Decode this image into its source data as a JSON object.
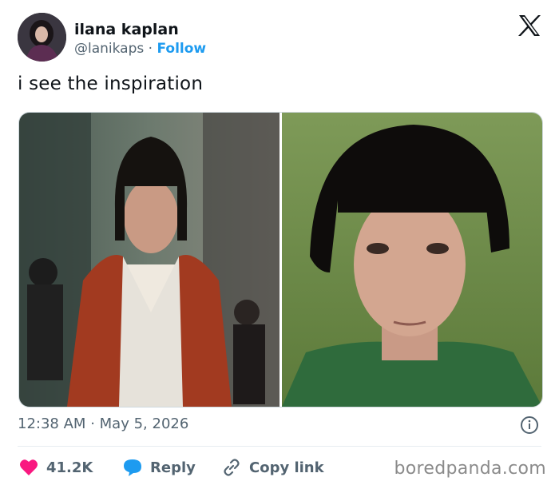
{
  "author": {
    "name": "ilana kaplan",
    "handle": "@lanikaps",
    "separator": "·",
    "follow_label": "Follow"
  },
  "tweet": {
    "text": "i see the inspiration",
    "time": "12:38 AM",
    "separator": "·",
    "date": "May 5, 2026"
  },
  "actions": {
    "likes": "41.2K",
    "reply_label": "Reply",
    "copy_label": "Copy link"
  },
  "watermark": "boredpanda.com",
  "colors": {
    "accent": "#1d9bf0",
    "like": "#f91880",
    "text": "#0f1419",
    "muted": "#536471"
  },
  "icons": [
    "x-logo-icon",
    "info-icon",
    "heart-icon",
    "reply-bubble-icon",
    "link-icon"
  ]
}
